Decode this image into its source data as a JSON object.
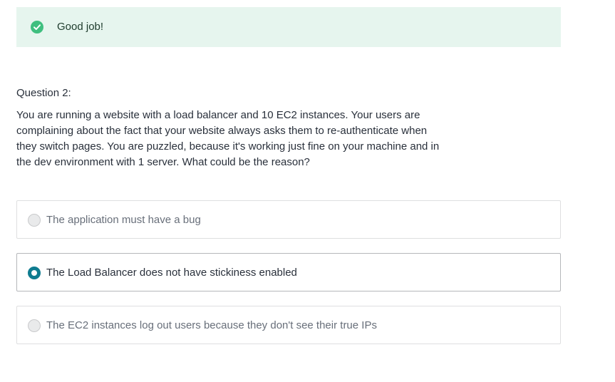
{
  "feedback": {
    "icon": "check-circle-icon",
    "message": "Good job!",
    "background_color": "#e6f5ee",
    "icon_color": "#3fbf7f"
  },
  "question": {
    "label": "Question 2:",
    "text": "You are running a website with a load balancer and 10 EC2 instances. Your users are complaining about the fact that your website always asks them to re-authenticate when they switch pages. You are puzzled, because it's working just fine on your machine and in the dev environment with 1 server. What could be the reason?"
  },
  "answers": [
    {
      "text": "The application must have a bug",
      "selected": false
    },
    {
      "text": "The Load Balancer does not have stickiness enabled",
      "selected": true
    },
    {
      "text": "The EC2 instances log out users because they don't see their true IPs",
      "selected": false
    }
  ],
  "colors": {
    "radio_selected": "#0f7c90"
  }
}
